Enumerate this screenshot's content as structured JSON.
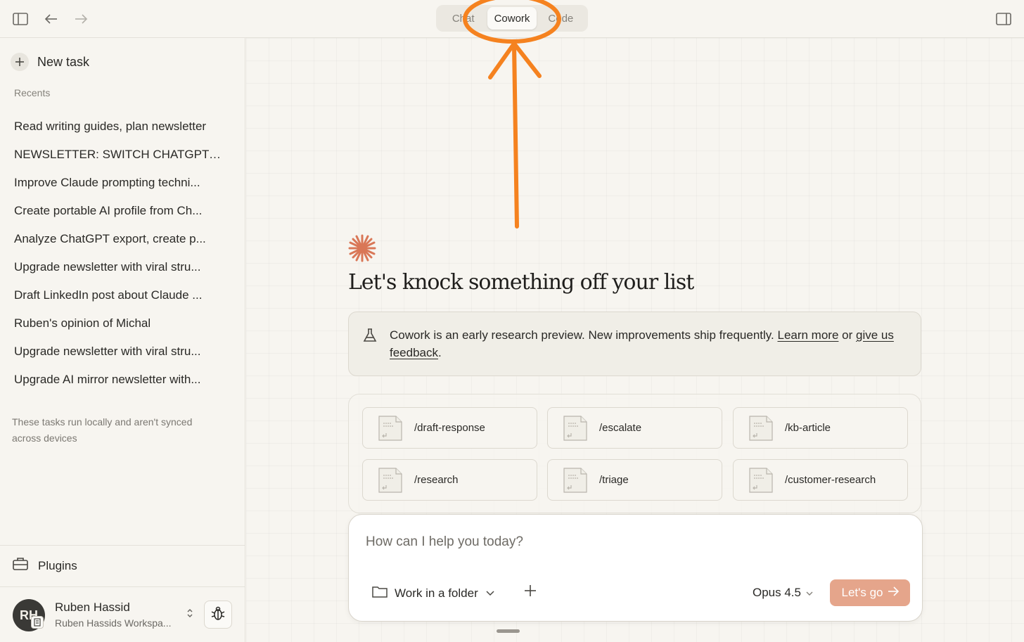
{
  "topbar": {
    "modes": [
      "Chat",
      "Cowork",
      "Code"
    ],
    "active_mode": "Cowork"
  },
  "sidebar": {
    "new_task_label": "New task",
    "recents_label": "Recents",
    "recents": [
      "Read writing guides, plan newsletter",
      "NEWSLETTER: SWITCH CHATGPT ...",
      "Improve Claude prompting techni...",
      "Create portable AI profile from Ch...",
      "Analyze ChatGPT export, create p...",
      "Upgrade newsletter with viral stru...",
      "Draft LinkedIn post about Claude ...",
      "Ruben's opinion of Michal",
      "Upgrade newsletter with viral stru...",
      "Upgrade AI mirror newsletter with..."
    ],
    "sync_note": "These tasks run locally and aren't synced across devices",
    "plugins_label": "Plugins",
    "user": {
      "initials": "RH",
      "name": "Ruben Hassid",
      "workspace": "Ruben Hassids Workspa..."
    }
  },
  "main": {
    "headline": "Let's knock something off your list",
    "notice": {
      "text": "Cowork is an early research preview. New improvements ship frequently.",
      "learn_more": "Learn more",
      "or": "or",
      "feedback": "give us feedback",
      "period": "."
    },
    "skills": [
      "/draft-response",
      "/escalate",
      "/kb-article",
      "/research",
      "/triage",
      "/customer-research"
    ],
    "composer": {
      "placeholder": "How can I help you today?",
      "folder_label": "Work in a folder",
      "model": "Opus 4.5",
      "submit_label": "Let's go"
    }
  },
  "colors": {
    "accent": "#e5a58b",
    "annotation": "#f5821f",
    "starburst": "#d97757"
  }
}
